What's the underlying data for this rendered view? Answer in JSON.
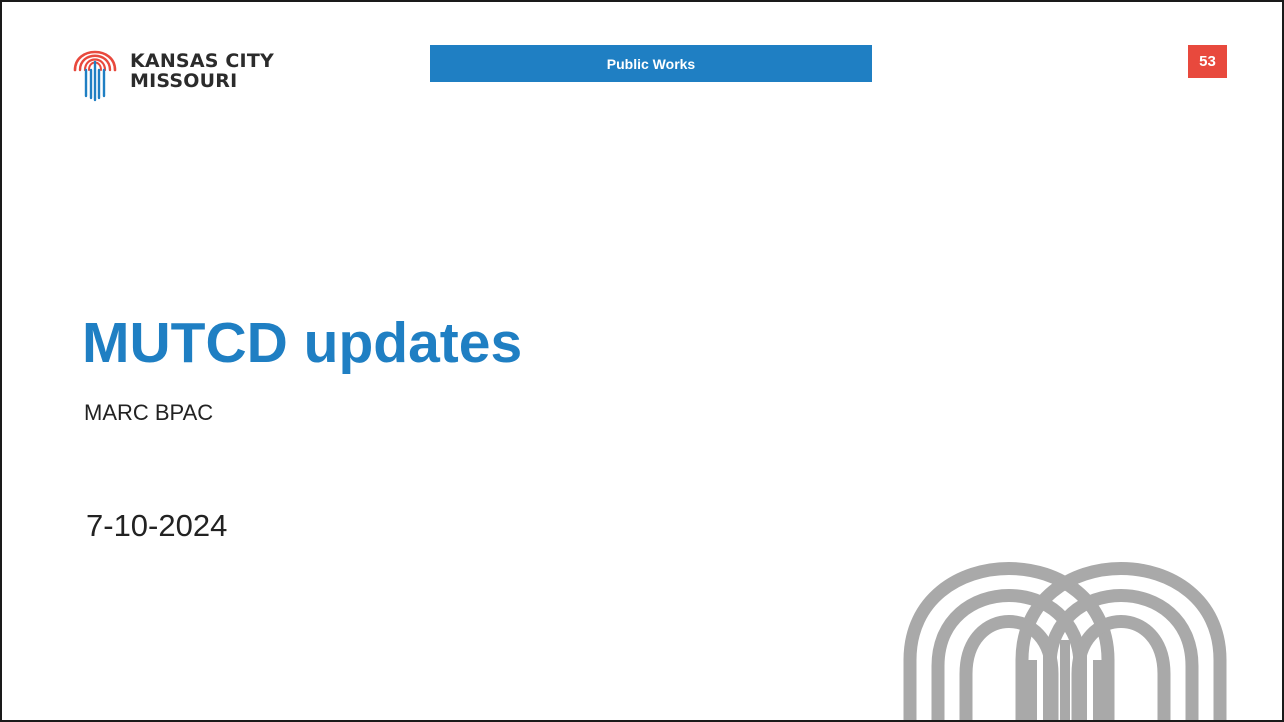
{
  "logo": {
    "icon": "fountain-logo-icon",
    "line1": "KANSAS CITY",
    "line2": "MISSOURI"
  },
  "header": {
    "department": "Public Works",
    "page_number": "53"
  },
  "slide": {
    "title": "MUTCD updates",
    "subtitle": "MARC BPAC",
    "date": "7-10-2024",
    "watermark_icon": "fountain-arches-watermark-icon"
  },
  "colors": {
    "brand_blue": "#1f7fc3",
    "badge_red": "#e8493d",
    "watermark_gray": "#a9a9a9",
    "text_dark": "#222222"
  }
}
